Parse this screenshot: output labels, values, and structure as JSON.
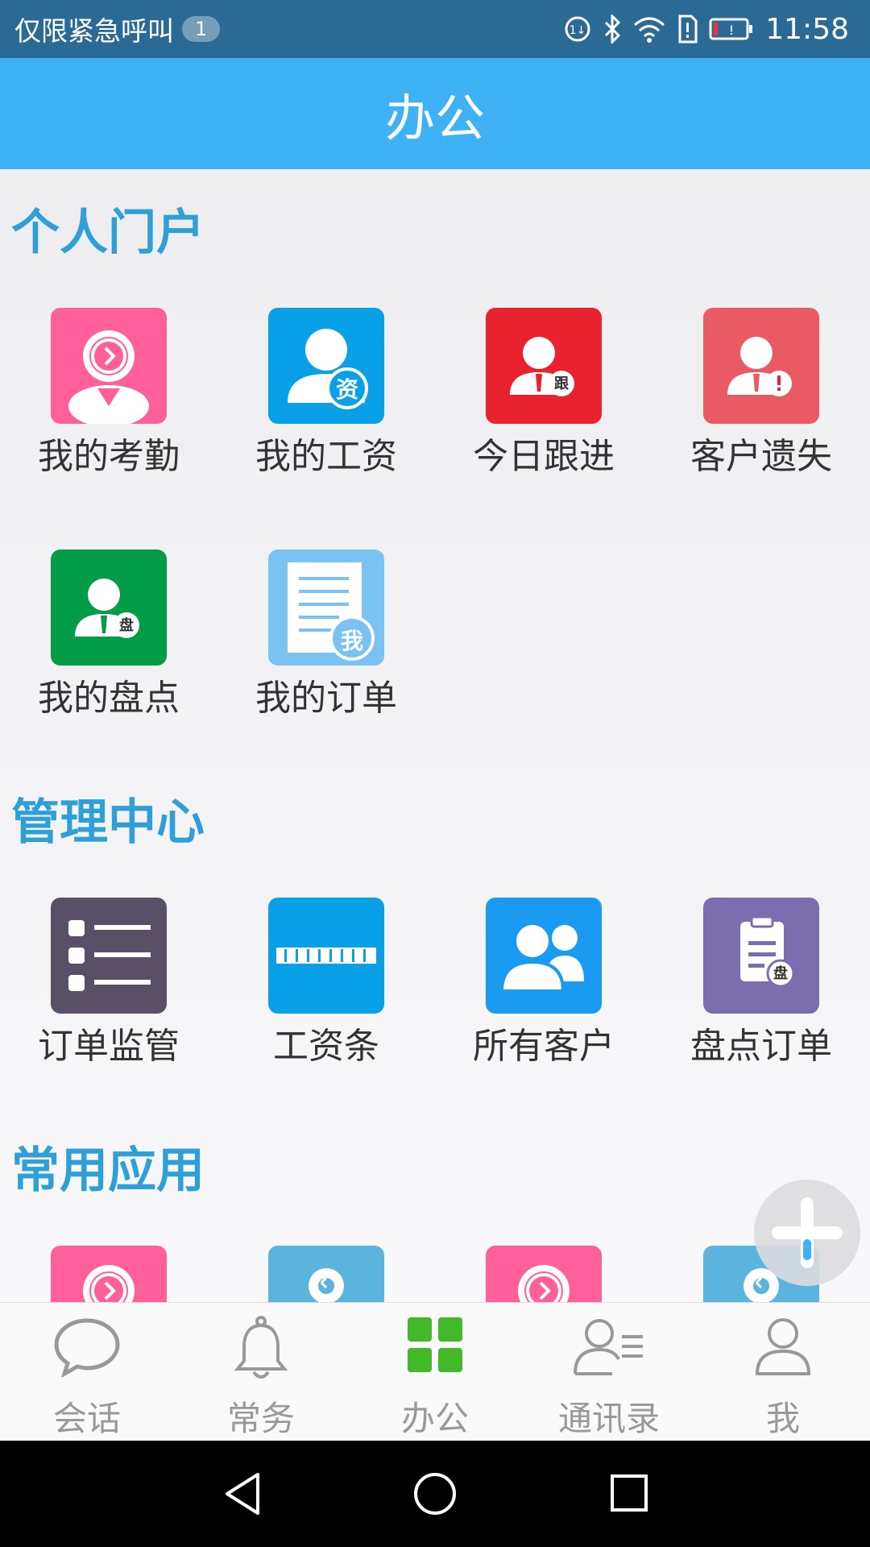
{
  "status_bar": {
    "carrier_text": "仅限紧急呼叫",
    "notification_count": "1",
    "time": "11:58",
    "icons": [
      "data-icon",
      "bluetooth-icon",
      "wifi-icon",
      "sim-alert-icon",
      "battery-low-icon"
    ]
  },
  "header": {
    "title": "办公"
  },
  "sections": [
    {
      "title": "个人门户",
      "items": [
        {
          "label": "我的考勤",
          "icon": "attendance-icon",
          "color": "#ff5f9b"
        },
        {
          "label": "我的工资",
          "icon": "salary-icon",
          "color": "#0aa0e8"
        },
        {
          "label": "今日跟进",
          "icon": "follow-up-icon",
          "color": "#e8222f"
        },
        {
          "label": "客户遗失",
          "icon": "customer-loss-icon",
          "color": "#ea5a64"
        },
        {
          "label": "我的盘点",
          "icon": "inventory-icon",
          "color": "#009c48"
        },
        {
          "label": "我的订单",
          "icon": "my-order-icon",
          "color": "#79c2f2"
        }
      ]
    },
    {
      "title": "管理中心",
      "items": [
        {
          "label": "订单监管",
          "icon": "order-supervision-icon",
          "color": "#595068"
        },
        {
          "label": "工资条",
          "icon": "payslip-icon",
          "color": "#0aa0e8"
        },
        {
          "label": "所有客户",
          "icon": "all-customers-icon",
          "color": "#1b9af2"
        },
        {
          "label": "盘点订单",
          "icon": "inventory-order-icon",
          "color": "#7b6dae"
        }
      ]
    },
    {
      "title": "常用应用",
      "items": [
        {
          "label": "",
          "icon": "attendance-icon",
          "color": "#ff5f9b"
        },
        {
          "label": "",
          "icon": "location-icon",
          "color": "#5ab4de"
        },
        {
          "label": "",
          "icon": "attendance-icon",
          "color": "#ff5f9b"
        },
        {
          "label": "",
          "icon": "location-icon",
          "color": "#5ab4de"
        }
      ]
    }
  ],
  "icon_glyphs": {
    "salary": "资",
    "follow_up": "跟",
    "inventory": "盘",
    "my_order": "我"
  },
  "bottom_nav": {
    "active_color": "#42b82a",
    "items": [
      {
        "label": "会话",
        "icon": "chat-icon"
      },
      {
        "label": "常务",
        "icon": "bell-icon"
      },
      {
        "label": "办公",
        "icon": "grid-icon",
        "active": true
      },
      {
        "label": "通讯录",
        "icon": "contacts-icon"
      },
      {
        "label": "我",
        "icon": "profile-icon"
      }
    ]
  },
  "system_nav": [
    "back-icon",
    "home-icon",
    "recents-icon"
  ]
}
